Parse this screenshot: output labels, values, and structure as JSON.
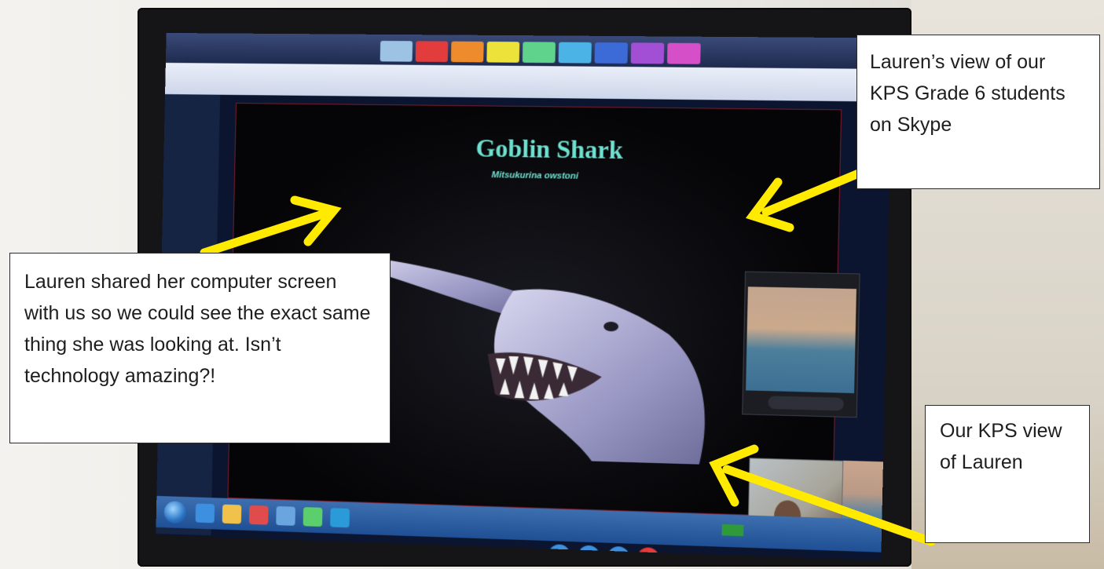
{
  "slide": {
    "title": "Goblin Shark",
    "subtitle": "Mitsukurina owstoni"
  },
  "callouts": {
    "left": "Lauren  shared her computer screen with us so we could see the exact same thing she was looking at. Isn’t technology amazing?!",
    "top_right": "Lauren’s view of our KPS Grade 6 students on Skype",
    "bottom_right": "Our KPS view of Lauren"
  },
  "colors": {
    "arrow": "#ffea00",
    "slide_text": "#6fe0cf",
    "call_buttons": [
      "#3d8fe0",
      "#3d8fe0",
      "#3d8fe0",
      "#e53b3b"
    ]
  },
  "icons": {
    "start": "windows-start-orb-icon",
    "call_controls": [
      "video-icon",
      "mic-icon",
      "add-icon",
      "hang-up-icon"
    ]
  }
}
